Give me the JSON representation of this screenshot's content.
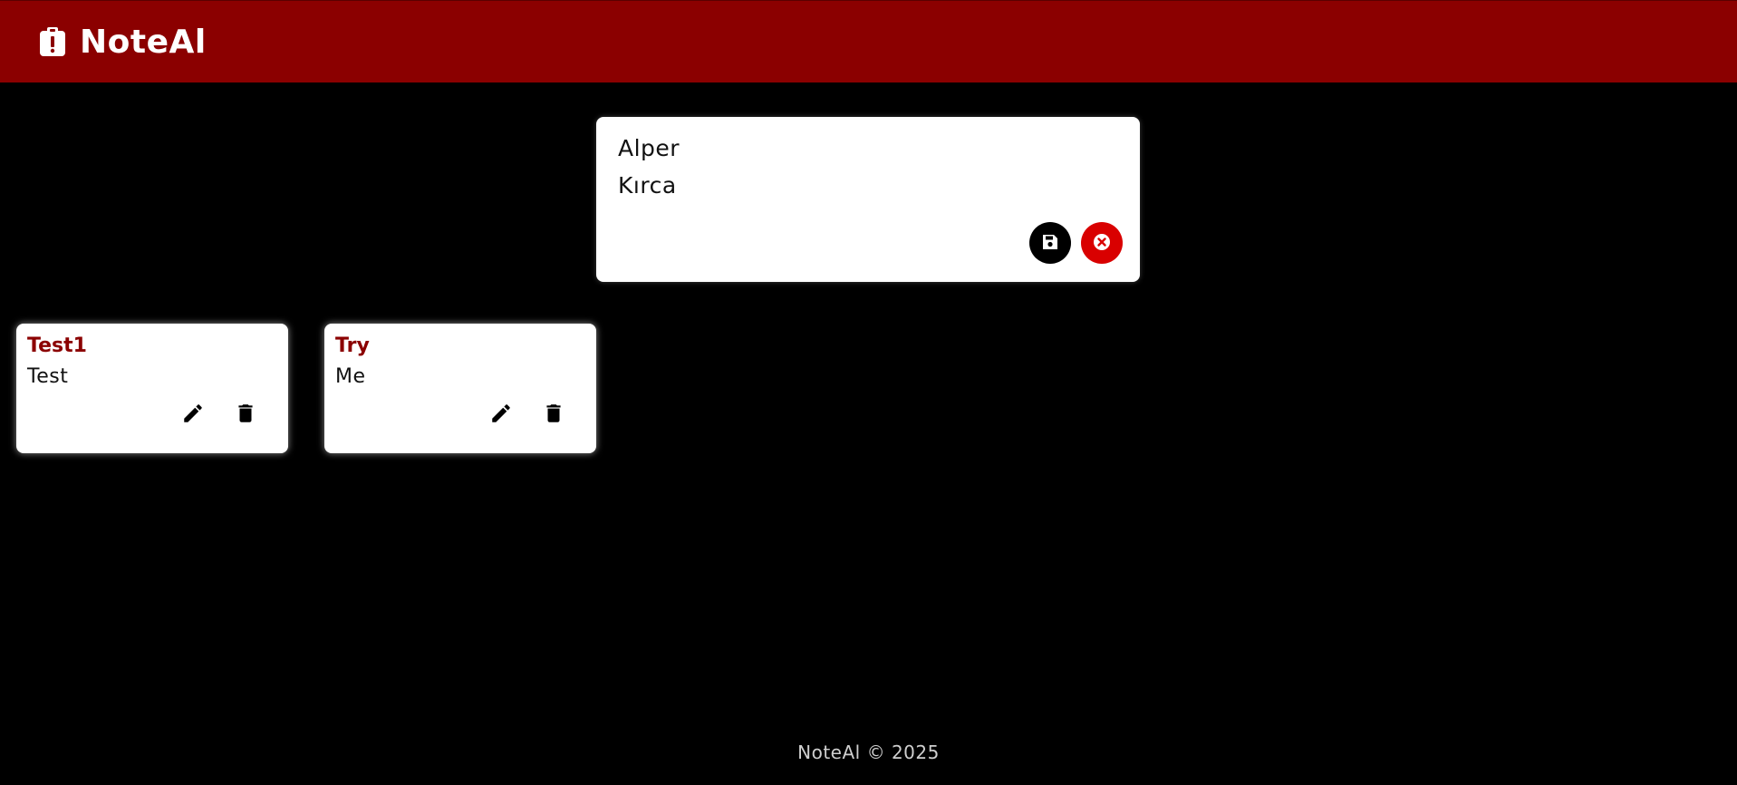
{
  "app": {
    "title": "NoteAl",
    "logo_icon": "clipboard-alert-icon",
    "header_color": "#8b0000"
  },
  "editor": {
    "title_value": "Alper",
    "content_value": "Kırca",
    "save_icon": "floppy-disk-icon",
    "cancel_icon": "circle-x-icon",
    "cancel_color": "#d90000"
  },
  "notes": [
    {
      "title": "Test1",
      "content": "Test",
      "edit_icon": "pencil-icon",
      "delete_icon": "trash-icon"
    },
    {
      "title": "Try",
      "content": "Me",
      "edit_icon": "pencil-icon",
      "delete_icon": "trash-icon"
    }
  ],
  "footer": {
    "text": "NoteAl © 2025"
  },
  "colors": {
    "background": "#000000",
    "note_title": "#8b0000",
    "card": "#ffffff"
  }
}
